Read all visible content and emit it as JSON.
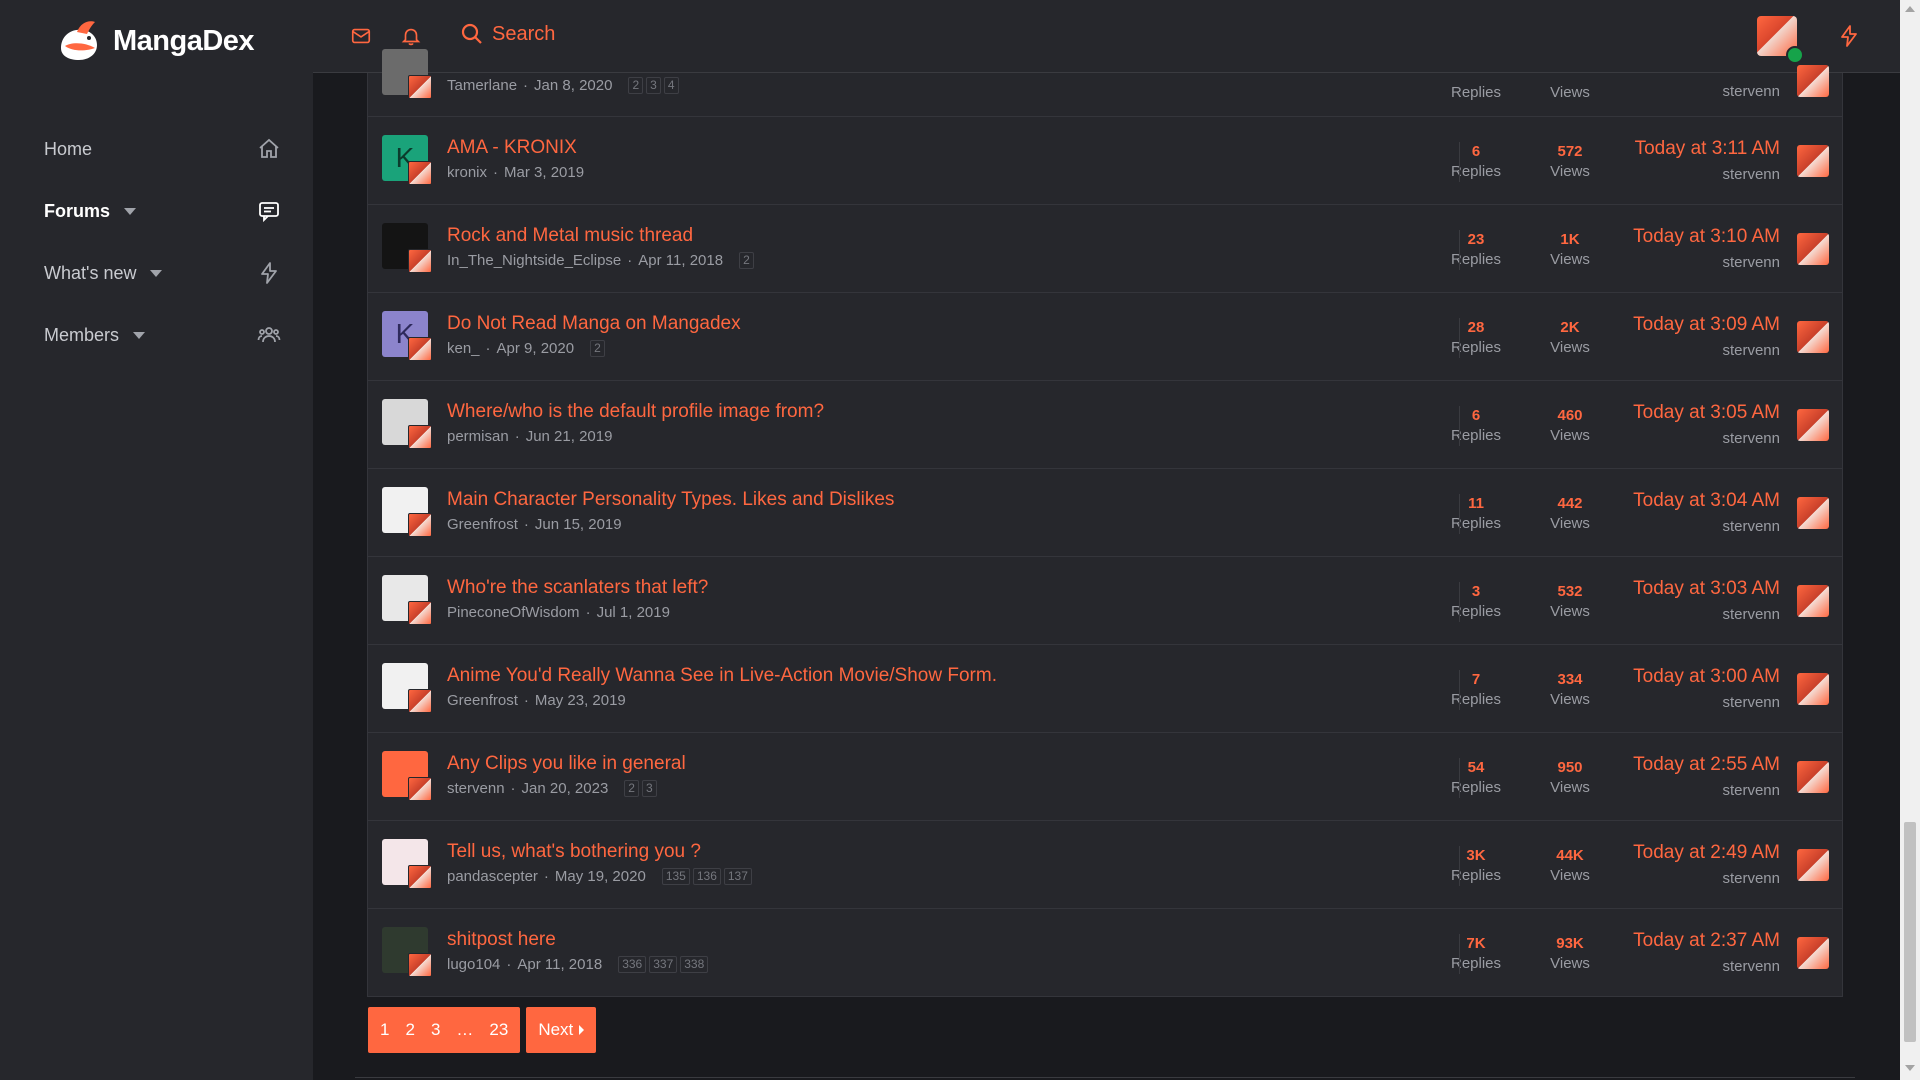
{
  "app": {
    "logo_text": "MangaDex",
    "accent_color": "#ff6740",
    "online_color": "#16a34a"
  },
  "sidebar": {
    "items": [
      {
        "label": "Home",
        "icon": "home-icon",
        "has_caret": false,
        "active": false
      },
      {
        "label": "Forums",
        "icon": "message-square-icon",
        "has_caret": true,
        "active": true
      },
      {
        "label": "What's new",
        "icon": "lightning-icon",
        "has_caret": true,
        "active": false
      },
      {
        "label": "Members",
        "icon": "users-icon",
        "has_caret": true,
        "active": false
      }
    ]
  },
  "header": {
    "search_label": "Search",
    "icons": [
      "mail-icon",
      "bell-icon",
      "search-icon",
      "lightning-icon"
    ]
  },
  "threads": [
    {
      "title": "",
      "author": "Tamerlane",
      "date": "Jan 8, 2020",
      "pages": [
        "2",
        "3",
        "4"
      ],
      "replies": "",
      "replies_label": "Replies",
      "views": "",
      "views_label": "Views",
      "last_time": "",
      "last_by": "stervenn",
      "avatar": {
        "letter": "",
        "bg": "#6b6b6b",
        "fg": "#ffffff"
      }
    },
    {
      "title": "AMA - KRONIX",
      "author": "kronix",
      "date": "Mar 3, 2019",
      "pages": [],
      "replies": "6",
      "replies_label": "Replies",
      "views": "572",
      "views_label": "Views",
      "last_time": "Today at 3:11 AM",
      "last_by": "stervenn",
      "avatar": {
        "letter": "K",
        "bg": "#1aa37a",
        "fg": "#0b3b2c"
      }
    },
    {
      "title": "Rock and Metal music thread",
      "author": "In_The_Nightside_Eclipse",
      "date": "Apr 11, 2018",
      "pages": [
        "2"
      ],
      "replies": "23",
      "replies_label": "Replies",
      "views": "1K",
      "views_label": "Views",
      "last_time": "Today at 3:10 AM",
      "last_by": "stervenn",
      "avatar": {
        "letter": "",
        "bg": "#141414",
        "fg": "#ffffff"
      }
    },
    {
      "title": "Do Not Read Manga on Mangadex",
      "author": "ken_",
      "date": "Apr 9, 2020",
      "pages": [
        "2"
      ],
      "replies": "28",
      "replies_label": "Replies",
      "views": "2K",
      "views_label": "Views",
      "last_time": "Today at 3:09 AM",
      "last_by": "stervenn",
      "avatar": {
        "letter": "K",
        "bg": "#8c84cc",
        "fg": "#2e2a5c"
      }
    },
    {
      "title": "Where/who is the default profile image from?",
      "author": "permisan",
      "date": "Jun 21, 2019",
      "pages": [],
      "replies": "6",
      "replies_label": "Replies",
      "views": "460",
      "views_label": "Views",
      "last_time": "Today at 3:05 AM",
      "last_by": "stervenn",
      "avatar": {
        "letter": "",
        "bg": "#d8d8d8",
        "fg": "#333333"
      }
    },
    {
      "title": "Main Character Personality Types. Likes and Dislikes",
      "author": "Greenfrost",
      "date": "Jun 15, 2019",
      "pages": [],
      "replies": "11",
      "replies_label": "Replies",
      "views": "442",
      "views_label": "Views",
      "last_time": "Today at 3:04 AM",
      "last_by": "stervenn",
      "avatar": {
        "letter": "",
        "bg": "#f1f1f1",
        "fg": "#b22222"
      }
    },
    {
      "title": "Who're the scanlaters that left?",
      "author": "PineconeOfWisdom",
      "date": "Jul 1, 2019",
      "pages": [],
      "replies": "3",
      "replies_label": "Replies",
      "views": "532",
      "views_label": "Views",
      "last_time": "Today at 3:03 AM",
      "last_by": "stervenn",
      "avatar": {
        "letter": "",
        "bg": "#e8e8e8",
        "fg": "#222222"
      }
    },
    {
      "title": "Anime You'd Really Wanna See in Live-Action Movie/Show Form.",
      "author": "Greenfrost",
      "date": "May 23, 2019",
      "pages": [],
      "replies": "7",
      "replies_label": "Replies",
      "views": "334",
      "views_label": "Views",
      "last_time": "Today at 3:00 AM",
      "last_by": "stervenn",
      "avatar": {
        "letter": "",
        "bg": "#f1f1f1",
        "fg": "#b22222"
      }
    },
    {
      "title": "Any Clips you like in general",
      "author": "stervenn",
      "date": "Jan 20, 2023",
      "pages": [
        "2",
        "3"
      ],
      "replies": "54",
      "replies_label": "Replies",
      "views": "950",
      "views_label": "Views",
      "last_time": "Today at 2:55 AM",
      "last_by": "stervenn",
      "avatar": {
        "letter": "",
        "bg": "#ff6740",
        "fg": "#ffffff"
      }
    },
    {
      "title": "Tell us, what's bothering you ?",
      "author": "pandascepter",
      "date": "May 19, 2020",
      "pages": [
        "135",
        "136",
        "137"
      ],
      "replies": "3K",
      "replies_label": "Replies",
      "views": "44K",
      "views_label": "Views",
      "last_time": "Today at 2:49 AM",
      "last_by": "stervenn",
      "avatar": {
        "letter": "",
        "bg": "#f4e6e9",
        "fg": "#c06070"
      }
    },
    {
      "title": "shitpost here",
      "author": "lugo104",
      "date": "Apr 11, 2018",
      "pages": [
        "336",
        "337",
        "338"
      ],
      "replies": "7K",
      "replies_label": "Replies",
      "views": "93K",
      "views_label": "Views",
      "last_time": "Today at 2:37 AM",
      "last_by": "stervenn",
      "avatar": {
        "letter": "",
        "bg": "#2f3a2f",
        "fg": "#ffffff"
      }
    }
  ],
  "pagination": {
    "pages": [
      "1",
      "2",
      "3",
      "…",
      "23"
    ],
    "next_label": "Next"
  }
}
